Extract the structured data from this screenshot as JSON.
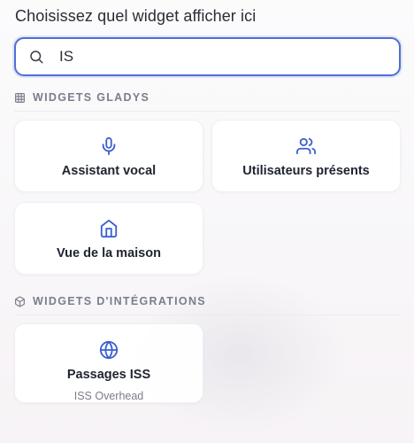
{
  "title": "Choisissez quel widget afficher ici",
  "search": {
    "value": "IS",
    "placeholder": ""
  },
  "sections": [
    {
      "label": "Widgets Gladys",
      "icon": "grid-icon",
      "cards": [
        {
          "label": "Assistant vocal",
          "icon": "microphone-icon"
        },
        {
          "label": "Utilisateurs présents",
          "icon": "users-icon"
        },
        {
          "label": "Vue de la maison",
          "icon": "home-icon"
        }
      ]
    },
    {
      "label": "Widgets d'intégrations",
      "icon": "box-icon",
      "cards": [
        {
          "label": "Passages ISS",
          "sublabel": "ISS Overhead",
          "icon": "globe-icon"
        }
      ]
    }
  ],
  "colors": {
    "accent": "#3b5fd1",
    "search_border": "#4f6fd6",
    "muted_text": "#7a7e8c"
  }
}
